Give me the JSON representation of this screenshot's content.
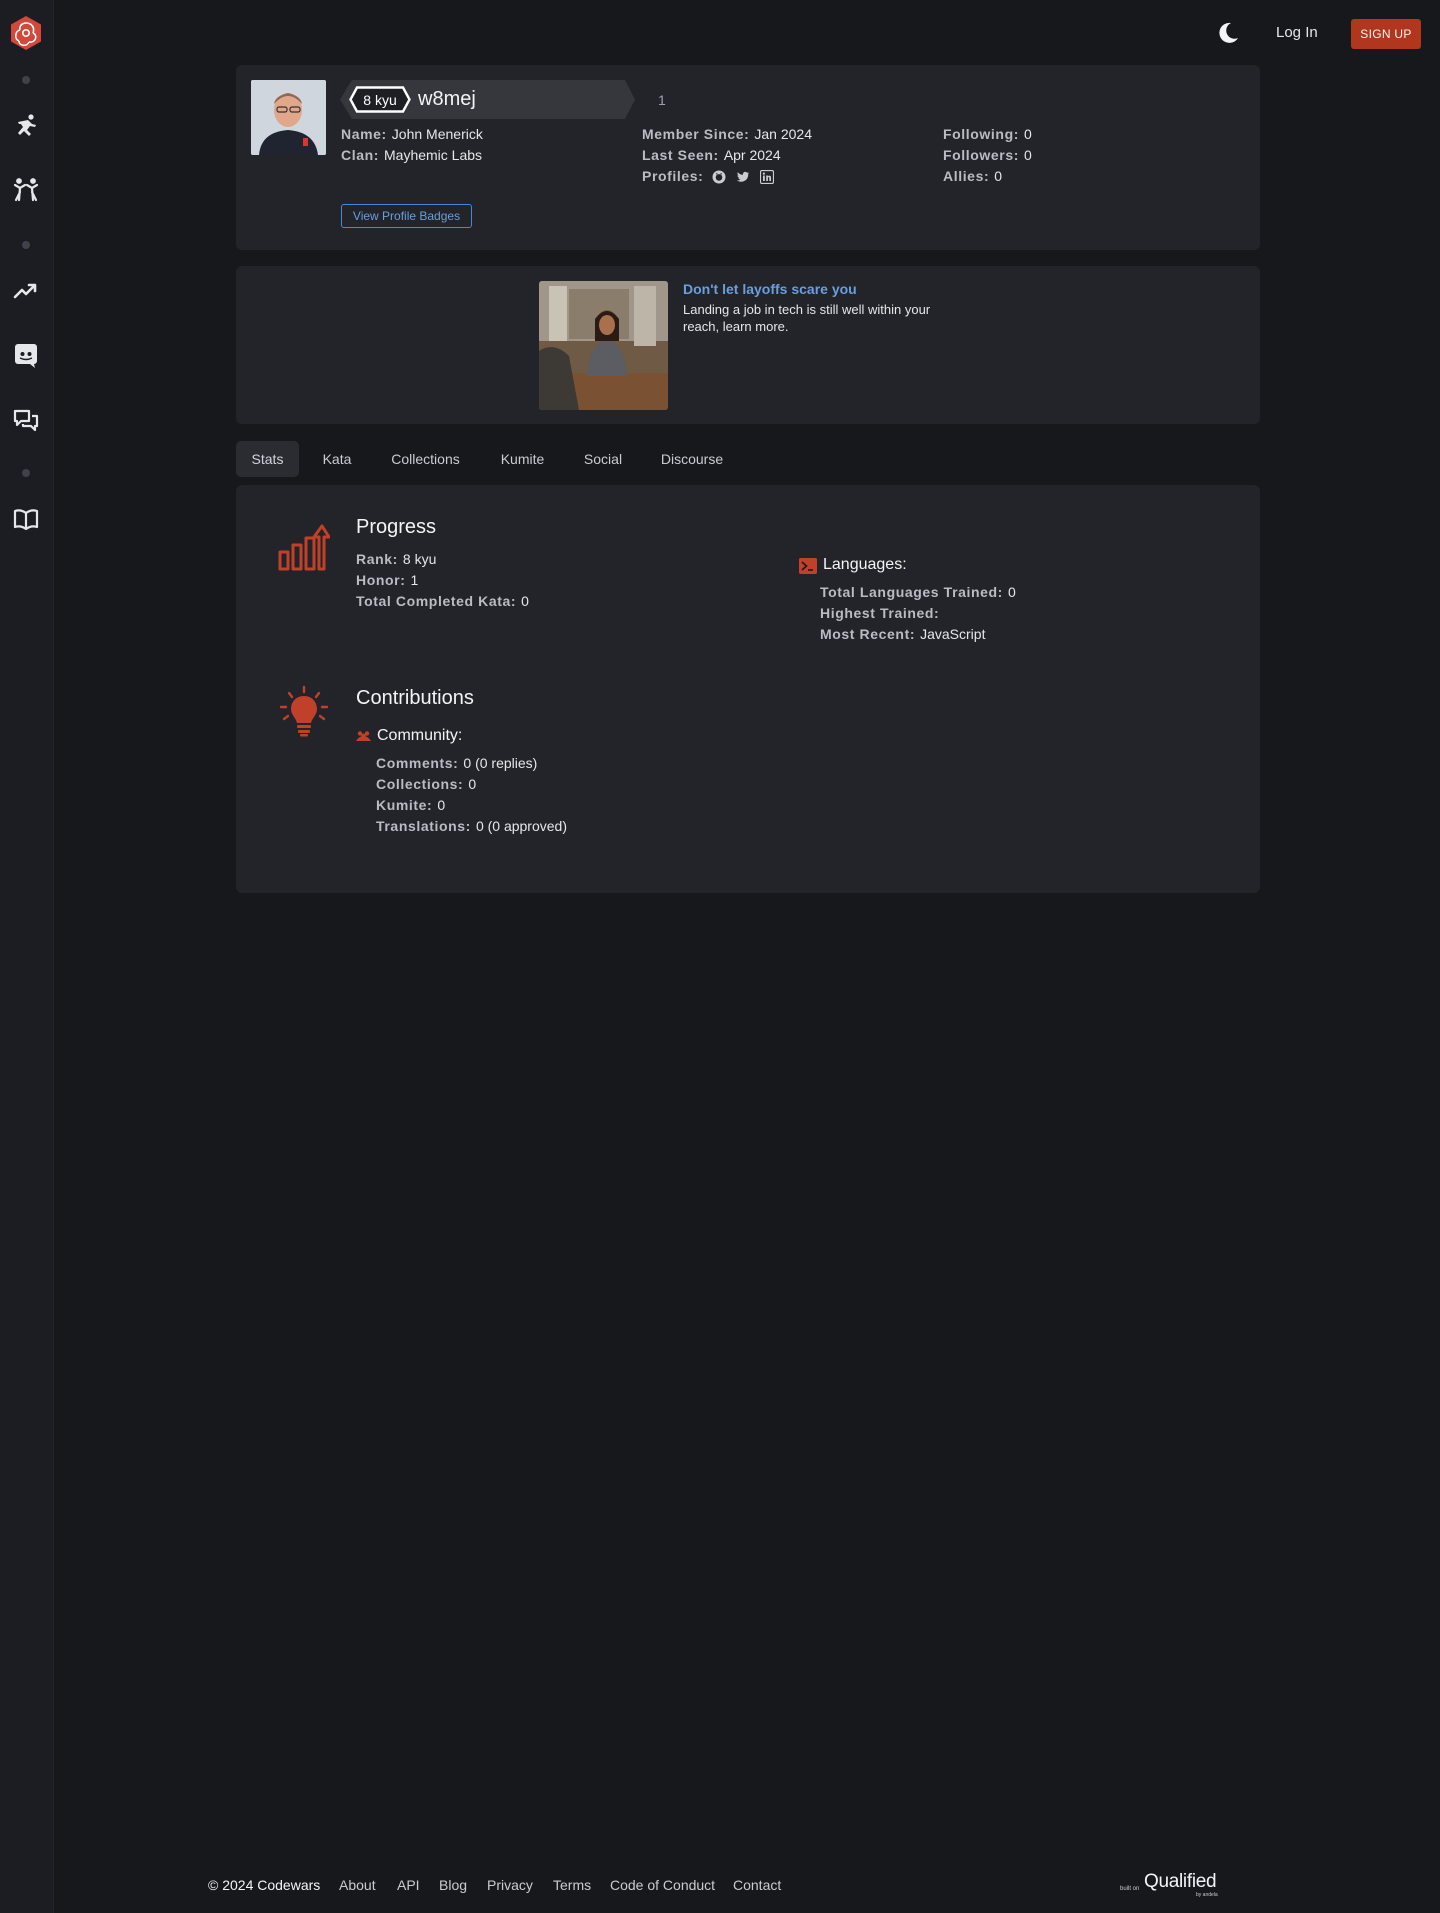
{
  "colors": {
    "brand_red": "#b1361e",
    "link_blue": "#6a9edf",
    "background": "#17181c",
    "panel": "#222429"
  },
  "sidebar": {
    "logo_icon": "codewars-logo-icon",
    "items": [
      {
        "icon": "training-icon"
      },
      {
        "icon": "kumite-icon"
      },
      {
        "icon": "leaderboard-icon"
      },
      {
        "icon": "discord-icon"
      },
      {
        "icon": "discussions-icon"
      },
      {
        "icon": "docs-icon"
      }
    ]
  },
  "header": {
    "theme_icon": "moon-icon",
    "login_label": "Log In",
    "signup_label": "SIGN UP"
  },
  "profile": {
    "rank_badge": "8 kyu",
    "username": "w8mej",
    "honor": "1",
    "name_label": "Name:",
    "name_value": "John Menerick",
    "clan_label": "Clan:",
    "clan_value": "Mayhemic Labs",
    "member_since_label": "Member Since:",
    "member_since_value": "Jan 2024",
    "last_seen_label": "Last Seen:",
    "last_seen_value": "Apr 2024",
    "profiles_label": "Profiles:",
    "profile_icons": [
      "github-icon",
      "twitter-icon",
      "linkedin-icon"
    ],
    "following_label": "Following:",
    "following_value": "0",
    "followers_label": "Followers:",
    "followers_value": "0",
    "allies_label": "Allies:",
    "allies_value": "0",
    "badges_button": "View Profile Badges"
  },
  "ad": {
    "title": "Don't let layoffs scare you",
    "text": "Landing a job in tech is still well within your reach, learn more."
  },
  "tabs": [
    {
      "label": "Stats",
      "active": true
    },
    {
      "label": "Kata",
      "active": false
    },
    {
      "label": "Collections",
      "active": false
    },
    {
      "label": "Kumite",
      "active": false
    },
    {
      "label": "Social",
      "active": false
    },
    {
      "label": "Discourse",
      "active": false
    }
  ],
  "progress": {
    "title": "Progress",
    "rank_label": "Rank:",
    "rank_value": "8 kyu",
    "honor_label": "Honor:",
    "honor_value": "1",
    "completed_label": "Total Completed Kata:",
    "completed_value": "0"
  },
  "languages": {
    "title": "Languages:",
    "trained_label": "Total Languages Trained:",
    "trained_value": "0",
    "highest_label": "Highest Trained:",
    "highest_value": "",
    "recent_label": "Most Recent:",
    "recent_value": "JavaScript"
  },
  "contributions": {
    "title": "Contributions",
    "community_title": "Community:",
    "comments_label": "Comments:",
    "comments_value": "0 (0 replies)",
    "collections_label": "Collections:",
    "collections_value": "0",
    "kumite_label": "Kumite:",
    "kumite_value": "0",
    "translations_label": "Translations:",
    "translations_value": "0 (0 approved)"
  },
  "footer": {
    "copyright": "© 2024 Codewars",
    "links": [
      "About",
      "API",
      "Blog",
      "Privacy",
      "Terms",
      "Code of Conduct",
      "Contact"
    ],
    "built_on": "built on",
    "qualified": "Qualified",
    "by": "by andela"
  }
}
